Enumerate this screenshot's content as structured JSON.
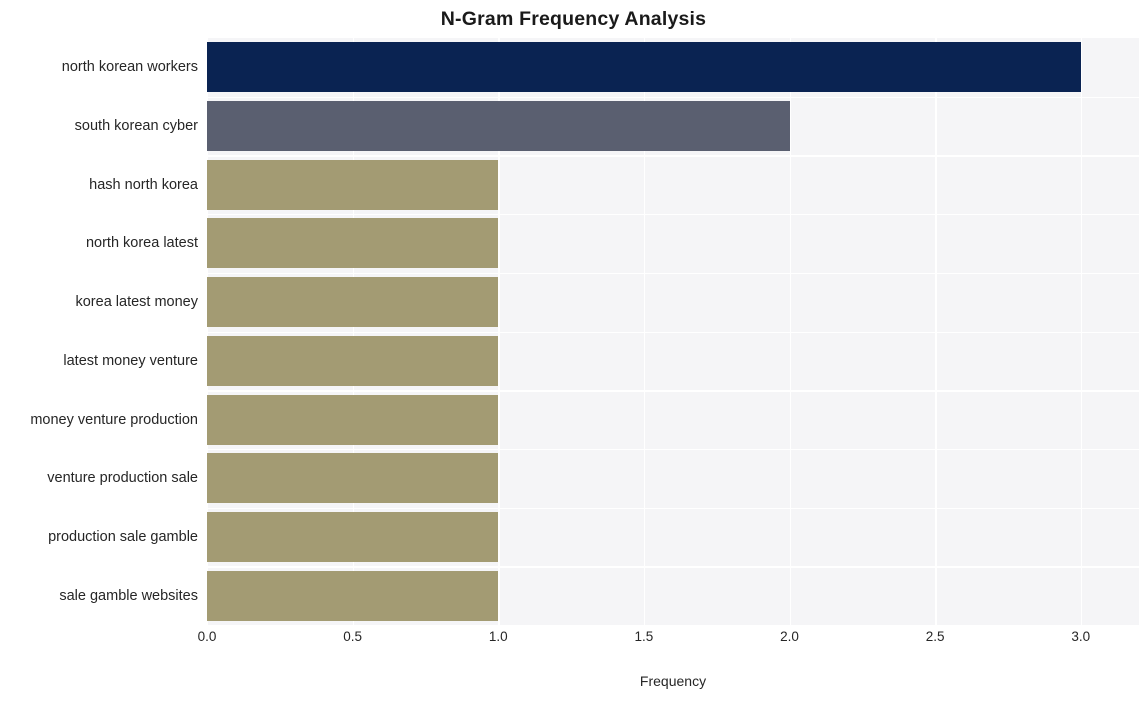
{
  "chart_data": {
    "type": "bar",
    "orientation": "horizontal",
    "title": "N-Gram Frequency Analysis",
    "xlabel": "Frequency",
    "ylabel": "",
    "xlim": [
      0,
      3.2
    ],
    "xticks": [
      "0.0",
      "0.5",
      "1.0",
      "1.5",
      "2.0",
      "2.5",
      "3.0"
    ],
    "xtick_values": [
      0,
      0.5,
      1,
      1.5,
      2,
      2.5,
      3
    ],
    "grid": true,
    "legend": "none",
    "categories": [
      "north korean workers",
      "south korean cyber",
      "hash north korea",
      "north korea latest",
      "korea latest money",
      "latest money venture",
      "money venture production",
      "venture production sale",
      "production sale gamble",
      "sale gamble websites"
    ],
    "values": [
      3,
      2,
      1,
      1,
      1,
      1,
      1,
      1,
      1,
      1
    ],
    "bar_colors": [
      "#0a2352",
      "#5a5f70",
      "#a39b73",
      "#a39b73",
      "#a39b73",
      "#a39b73",
      "#a39b73",
      "#a39b73",
      "#a39b73",
      "#a39b73"
    ],
    "plot_background": "#f5f5f7",
    "figure_background": "#ffffff",
    "gridline_color": "#ffffff"
  }
}
